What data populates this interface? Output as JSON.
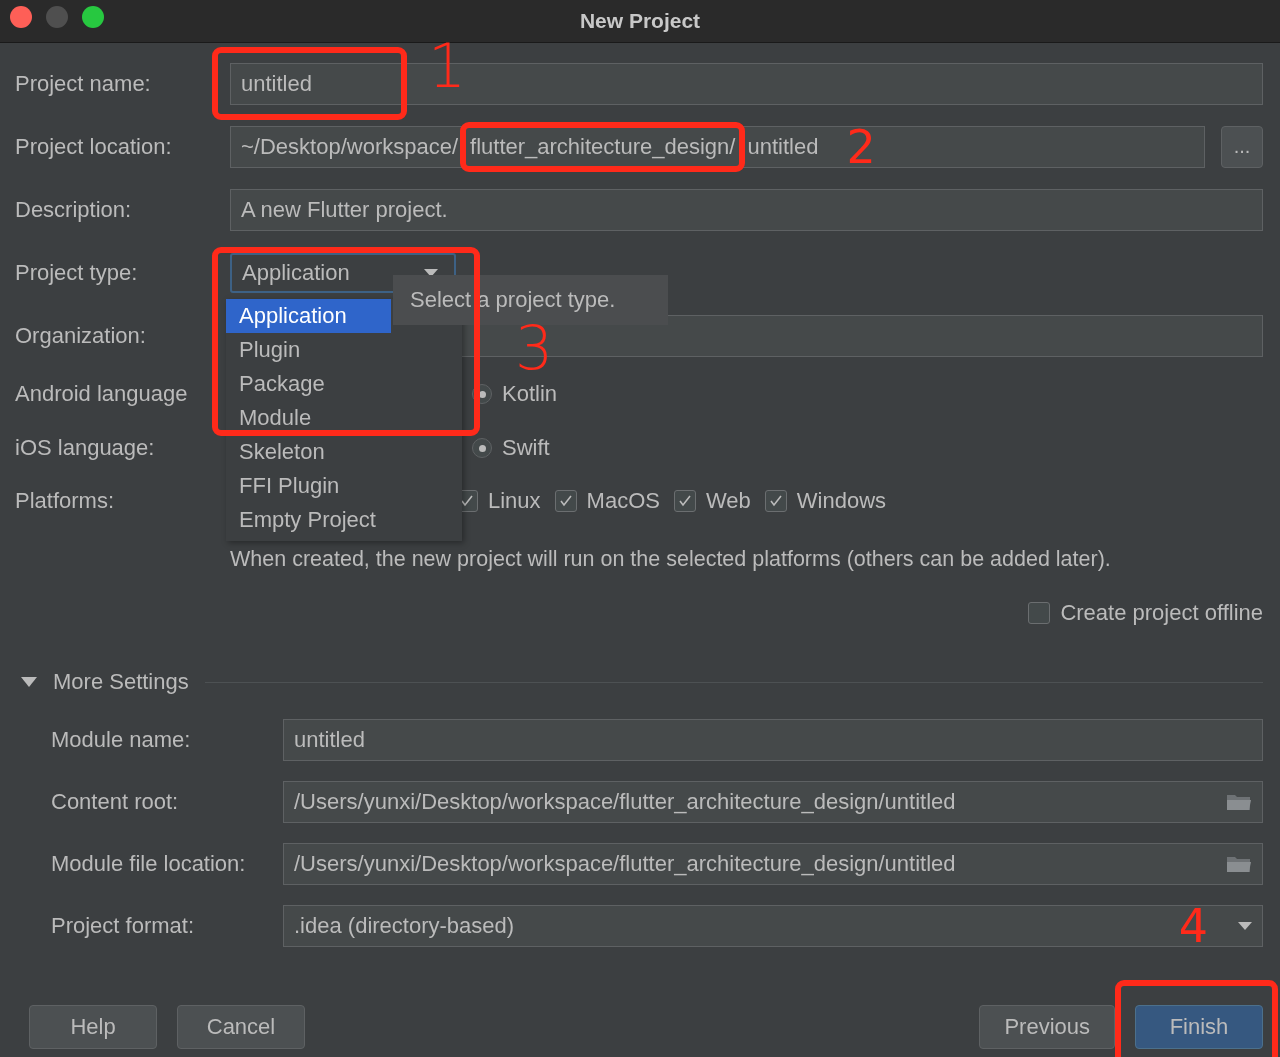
{
  "window": {
    "title": "New Project"
  },
  "fields": [
    {
      "kind": "text",
      "label": "Project name:",
      "value": "untitled"
    },
    {
      "kind": "browse",
      "label": "Project location:",
      "value_parts": [
        "~/Desktop/workspace/",
        "flutter_architecture_design/",
        "untitled"
      ],
      "button": "..."
    },
    {
      "kind": "text",
      "label": "Description:",
      "value": "A new Flutter project."
    },
    {
      "kind": "combo",
      "label": "Project type:",
      "value": "Application"
    },
    {
      "kind": "text",
      "label": "Organization:"
    },
    {
      "kind": "radio",
      "label": "Android language",
      "options": [
        {
          "label": "Kotlin",
          "selected": true
        }
      ]
    },
    {
      "kind": "radio",
      "label": "iOS language:",
      "options": [
        {
          "label": "Swift",
          "selected": true
        }
      ]
    },
    {
      "kind": "checks",
      "label": "Platforms:",
      "options": [
        {
          "label": "Linux",
          "checked": true
        },
        {
          "label": "MacOS",
          "checked": true
        },
        {
          "label": "Web",
          "checked": true
        },
        {
          "label": "Windows",
          "checked": true
        }
      ]
    }
  ],
  "platforms_hint": "When created, the new project will run on the selected platforms (others can be added later).",
  "offline": {
    "label": "Create project offline",
    "checked": false
  },
  "more_settings": {
    "label": "More Settings",
    "expanded": true,
    "fields": [
      {
        "kind": "text",
        "label": "Module name:",
        "value": "untitled"
      },
      {
        "kind": "folder",
        "label": "Content root:",
        "value": "/Users/yunxi/Desktop/workspace/flutter_architecture_design/untitled"
      },
      {
        "kind": "folder",
        "label": "Module file location:",
        "value": "/Users/yunxi/Desktop/workspace/flutter_architecture_design/untitled"
      },
      {
        "kind": "combo",
        "label": "Project format:",
        "value": ".idea (directory-based)"
      }
    ]
  },
  "project_type_popup": {
    "items": [
      {
        "label": "Application",
        "selected": true
      },
      {
        "label": "Plugin",
        "selected": false
      },
      {
        "label": "Package",
        "selected": false
      },
      {
        "label": "Module",
        "selected": false
      },
      {
        "label": "Skeleton",
        "selected": false
      },
      {
        "label": "FFI Plugin",
        "selected": false
      },
      {
        "label": "Empty Project",
        "selected": false
      }
    ],
    "tooltip": "Select a project type."
  },
  "buttons_left": [
    {
      "label": "Help",
      "default": false
    },
    {
      "label": "Cancel",
      "default": false
    }
  ],
  "buttons_right": [
    {
      "label": "Previous",
      "default": false
    },
    {
      "label": "Finish",
      "default": true
    }
  ],
  "annotations": [
    {
      "label": "1"
    },
    {
      "label": "2",
      "kind": "inline",
      "number_in_field": true
    },
    {
      "label": "3"
    },
    {
      "label": "4",
      "number_in_field": true
    }
  ]
}
